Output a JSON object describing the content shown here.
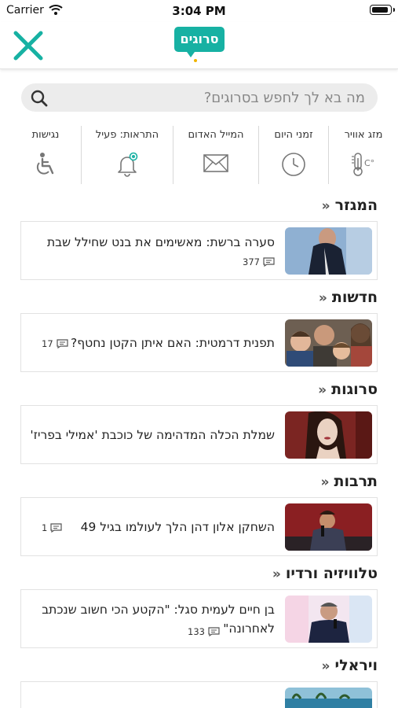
{
  "status": {
    "carrier": "Carrier",
    "time": "3:04 PM",
    "battery_level": 0.95
  },
  "header": {
    "logo": "סרוגים"
  },
  "search": {
    "placeholder": "מה בא לך לחפש בסרוגים?"
  },
  "shortcuts": [
    {
      "label": "מזג אוויר",
      "icon": "thermometer-icon"
    },
    {
      "label": "זמני היום",
      "icon": "clock-icon"
    },
    {
      "label": "המייל האדום",
      "icon": "mail-icon"
    },
    {
      "label": "התראות: פעיל",
      "icon": "bell-icon"
    },
    {
      "label": "נגישות",
      "icon": "wheelchair-icon"
    }
  ],
  "sections": [
    {
      "title": "המגזר",
      "article": {
        "headline": "סערה ברשת: מאשימים את בנט שחילל שבת",
        "comments": "377"
      }
    },
    {
      "title": "חדשות",
      "article": {
        "headline": "תפנית דרמטית: האם איתן הקטן נחטף?",
        "comments": "17"
      }
    },
    {
      "title": "סרוגות",
      "article": {
        "headline": "שמלת הכלה המדהימה של כוכבת 'אמילי בפריז'",
        "comments": ""
      }
    },
    {
      "title": "תרבות",
      "article": {
        "headline": "השחקן אלון דהן הלך לעולמו בגיל 49",
        "comments": "1"
      }
    },
    {
      "title": "טלוויזיה ורדיו",
      "article": {
        "headline": "בן חיים לעמית סגל: \"הקטע הכי חשוב שנכתב לאחרונה\"",
        "comments": "133"
      }
    },
    {
      "title": "ויראלי",
      "article": {
        "headline": "",
        "comments": ""
      }
    }
  ],
  "colors": {
    "brand": "#17b1a3",
    "accent_yellow": "#f0b400",
    "search_bg": "#ececec"
  }
}
